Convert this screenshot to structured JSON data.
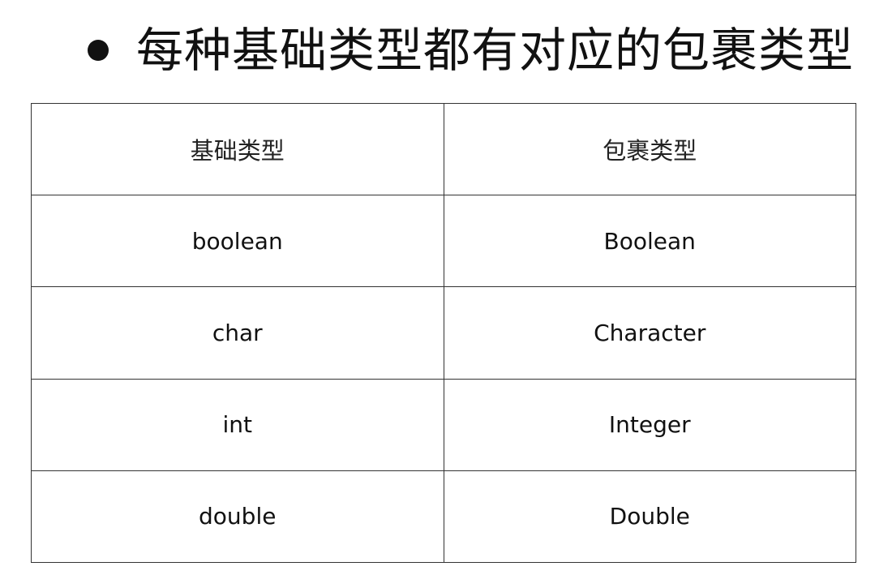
{
  "slide": {
    "title": "每种基础类型都有对应的包裹类型"
  },
  "table": {
    "headers": [
      "基础类型",
      "包裹类型"
    ],
    "rows": [
      [
        "boolean",
        "Boolean"
      ],
      [
        "char",
        "Character"
      ],
      [
        "int",
        "Integer"
      ],
      [
        "double",
        "Double"
      ]
    ]
  }
}
